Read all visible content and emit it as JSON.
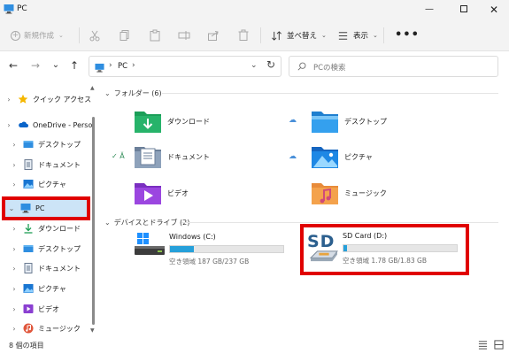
{
  "window": {
    "title": "PC"
  },
  "titlebar": {
    "min": "—",
    "close": "✕"
  },
  "toolbar": {
    "new_label": "新規作成",
    "sort_label": "並べ替え",
    "view_label": "表示",
    "more": "•••",
    "icons": [
      "cut-icon",
      "copy-icon",
      "paste-icon",
      "rename-icon",
      "share-icon",
      "delete-icon"
    ]
  },
  "nav": {
    "back": "←",
    "forward": "→",
    "recent": "⌄",
    "up": "↑",
    "refresh": "↻"
  },
  "address": {
    "crumb": "PC",
    "sep": "›",
    "dropdown": "⌄"
  },
  "search": {
    "placeholder": "PCの検索"
  },
  "sidebar": {
    "items": [
      {
        "label": "クイック アクセス",
        "expander": "›"
      },
      {
        "label": "OneDrive - Perso",
        "expander": "›"
      },
      {
        "label": "デスクトップ",
        "expander": "›"
      },
      {
        "label": "ドキュメント",
        "expander": "›"
      },
      {
        "label": "ピクチャ",
        "expander": "›"
      },
      {
        "label": "PC",
        "expander": "⌄"
      },
      {
        "label": "ダウンロード",
        "expander": "›"
      },
      {
        "label": "デスクトップ",
        "expander": "›"
      },
      {
        "label": "ドキュメント",
        "expander": "›"
      },
      {
        "label": "ピクチャ",
        "expander": "›"
      },
      {
        "label": "ビデオ",
        "expander": "›"
      },
      {
        "label": "ミュージック",
        "expander": "›"
      }
    ]
  },
  "folders_group": {
    "title": "フォルダー (6)",
    "chev": "⌄"
  },
  "folders": [
    {
      "name": "ダウンロード"
    },
    {
      "name": "デスクトップ"
    },
    {
      "name": "ドキュメント"
    },
    {
      "name": "ピクチャ"
    },
    {
      "name": "ビデオ"
    },
    {
      "name": "ミュージック"
    }
  ],
  "drives_group": {
    "title": "デバイスとドライブ (2)",
    "chev": "⌄"
  },
  "drives": [
    {
      "name": "Windows (C:)",
      "space": "空き領域 187 GB/237 GB",
      "used_fraction": 0.21
    },
    {
      "name": "SD Card (D:)",
      "space": "空き領域 1.78 GB/1.83 GB",
      "used_fraction": 0.03,
      "badge": "SD"
    }
  ],
  "status": {
    "text": "8 個の項目"
  },
  "colors": {
    "accent": "#0078d4",
    "highlight": "#e00000",
    "selected": "#cce4f7",
    "bar": "#26a0da"
  }
}
